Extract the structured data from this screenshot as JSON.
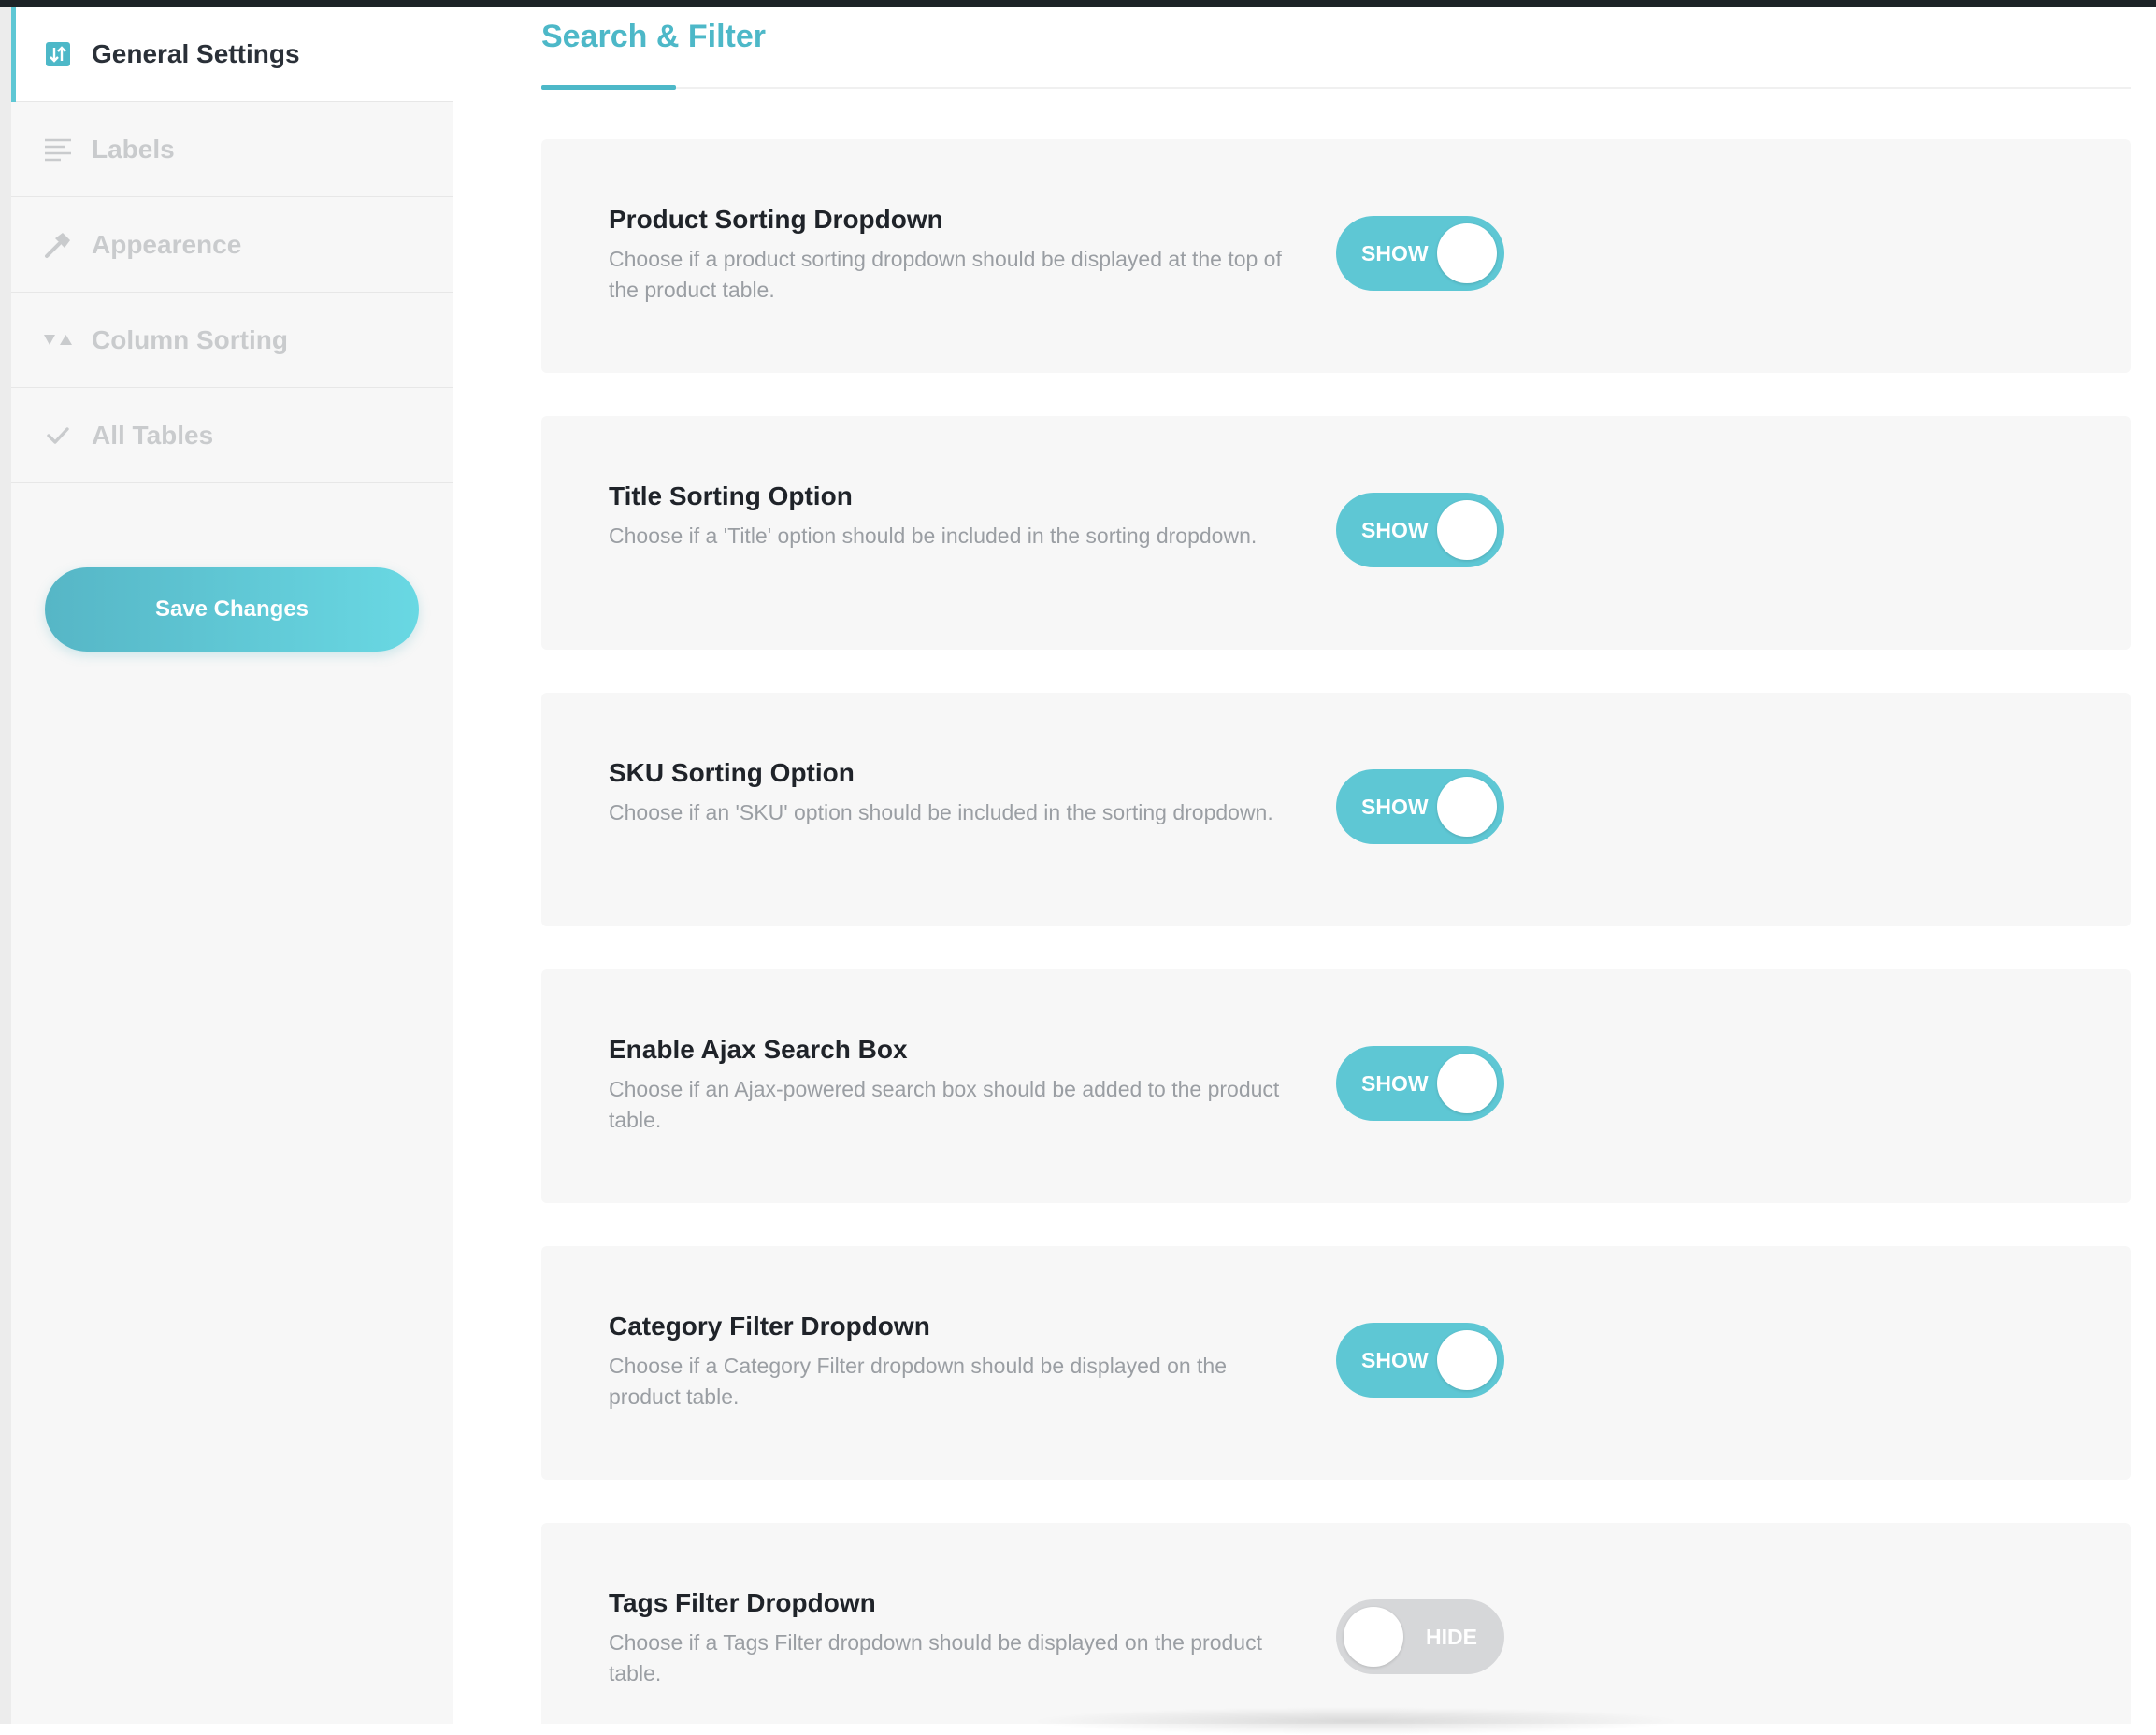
{
  "sidebar": {
    "items": [
      {
        "label": "General Settings",
        "icon": "sliders-icon",
        "active": true
      },
      {
        "label": "Labels",
        "icon": "lines-icon",
        "active": false
      },
      {
        "label": "Appearence",
        "icon": "hammer-icon",
        "active": false
      },
      {
        "label": "Column Sorting",
        "icon": "sort-triangles-icon",
        "active": false
      },
      {
        "label": "All Tables",
        "icon": "checkmark-icon",
        "active": false
      }
    ],
    "save_label": "Save Changes"
  },
  "main": {
    "title": "Search & Filter",
    "settings": [
      {
        "title": "Product Sorting Dropdown",
        "description": "Choose if a product sorting dropdown should be displayed at the top of the product table.",
        "state": "SHOW",
        "on": true
      },
      {
        "title": "Title Sorting Option",
        "description": "Choose if a 'Title' option should be included in the sorting dropdown.",
        "state": "SHOW",
        "on": true
      },
      {
        "title": "SKU Sorting Option",
        "description": "Choose if an 'SKU' option should be included in the sorting dropdown.",
        "state": "SHOW",
        "on": true
      },
      {
        "title": "Enable Ajax Search Box",
        "description": "Choose if an Ajax-powered search box should be added to the product table.",
        "state": "SHOW",
        "on": true
      },
      {
        "title": "Category Filter Dropdown",
        "description": "Choose if a Category Filter dropdown should be displayed on the product table.",
        "state": "SHOW",
        "on": true
      },
      {
        "title": "Tags Filter Dropdown",
        "description": "Choose if a Tags Filter dropdown should be displayed on the product table.",
        "state": "HIDE",
        "on": false
      }
    ]
  },
  "colors": {
    "accent": "#5ec7d4",
    "title": "#4db8c8",
    "toggle_off": "#d6d7d9"
  }
}
